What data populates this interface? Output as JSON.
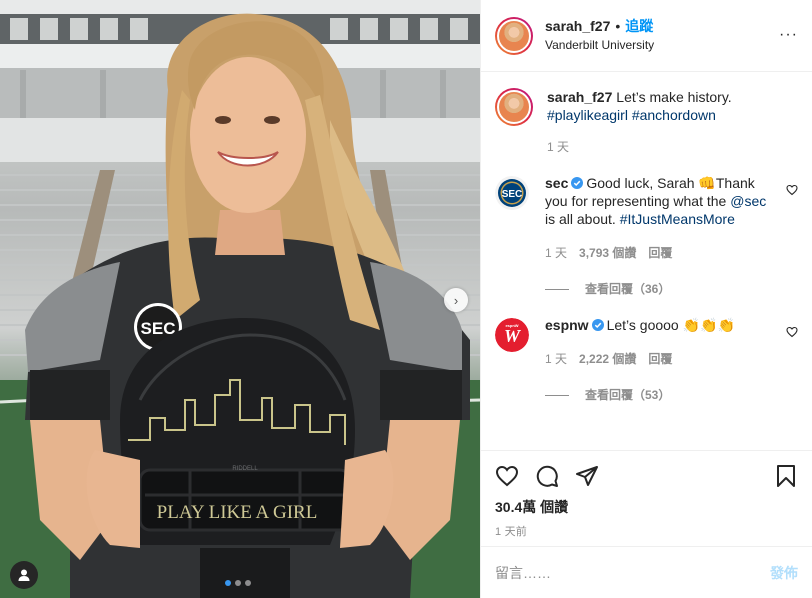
{
  "post": {
    "username": "sarah_f27",
    "separator": "•",
    "follow_label": "追蹤",
    "location": "Vanderbilt University",
    "more_icon": "more-horizontal-icon",
    "more_label": "···"
  },
  "caption": {
    "username": "sarah_f27",
    "text": "Let’s make history.",
    "hashtags": "#playlikeagirl #anchordown",
    "time": "1 天"
  },
  "comments": [
    {
      "username": "sec",
      "verified": true,
      "text_part1": "Good luck, Sarah ",
      "emoji": "👊",
      "text_part2": "Thank you for representing what the ",
      "mention": "@sec",
      "text_part3": " is all about. ",
      "hashtag": "#ItJustMeansMore",
      "time": "1 天",
      "likes": "3,793 個讚",
      "reply_label": "回覆",
      "view_replies": "查看回覆（36）"
    },
    {
      "username": "espnw",
      "verified": true,
      "text": "Let’s goooo ",
      "emoji": "👏👏👏",
      "time": "1 天",
      "likes": "2,222 個讚",
      "reply_label": "回覆",
      "view_replies": "查看回覆（53）"
    }
  ],
  "photo": {
    "jersey_logo": "SEC",
    "helmet_text": "PLAY LIKE A GIRL",
    "helmet_brand": "RIDDELL",
    "slide_count": 3,
    "active_slide": 1,
    "next_icon": "chevron-right-icon",
    "next_label": "›"
  },
  "actions": {
    "likes_count": "30.4萬 個讚",
    "posted_time": "1 天前"
  },
  "add_comment": {
    "placeholder": "留言……",
    "post_label": "發佈"
  },
  "colors": {
    "link_blue": "#0095f6",
    "hashtag_blue": "#00376b",
    "muted_gray": "#8e8e8e",
    "post_disabled": "#b2dffc",
    "espn_red": "#e41e2f",
    "sec_navy": "#00427a"
  }
}
